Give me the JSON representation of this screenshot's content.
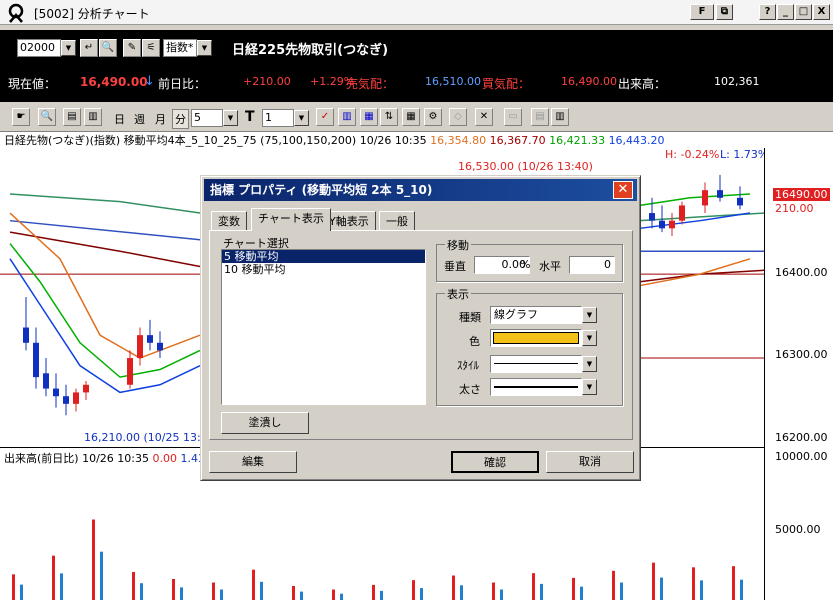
{
  "window": {
    "title": "[5002] 分析チャート",
    "btn_f": "F",
    "btn_help": "?",
    "btn_min": "_",
    "btn_max": "□",
    "btn_close": "X"
  },
  "top": {
    "code": "02000",
    "interval": "指数*",
    "instrument": "日経225先物取引(つなぎ)"
  },
  "quote": {
    "current_label": "現在値：",
    "current_value": "16,490.00",
    "arrow": "↓",
    "prev_label": "前日比：",
    "change": "+210.00",
    "change_pct": "+1.29%",
    "ask_label": "売気配：",
    "ask_value": "16,510.00",
    "bid_label": "買気配：",
    "bid_value": "16,490.00",
    "volume_label": "出来高：",
    "volume_value": "102,361"
  },
  "toolbar": {
    "day": "日",
    "week": "週",
    "month": "月",
    "minute": "分",
    "minute_value": "5",
    "t_value": "1",
    "t_label": "T"
  },
  "legend": {
    "main": "日経先物(つなぎ)(指数) 移動平均4本_5_10_25_75 (75,100,150,200) 10/26 10:35",
    "v1": "16,354.80",
    "v2": "16,367.70",
    "v3": "16,421.33",
    "v4": "16,443.20"
  },
  "annotations": {
    "high": "16,530.00 (10/26 13:40)",
    "low": "16,210.00 (10/25 13:",
    "h_label": "H: -0.24%",
    "l_label": "L: 1.73%"
  },
  "axis": {
    "price_current": "16490.00",
    "price_change": "210.00",
    "ticks": [
      "16400.00",
      "16300.00",
      "16200.00"
    ],
    "vol_ticks": [
      "10000.00",
      "5000.00"
    ]
  },
  "volume": {
    "legend": "出来高(前日比) 10/26 10:35",
    "v_neg": "0.00",
    "v_pos": "1.43"
  },
  "dialog": {
    "title": "指標 プロパティ (移動平均短 2本 5_10)",
    "tabs": [
      "変数",
      "チャート表示",
      "Y軸表示",
      "一般"
    ],
    "list_label": "チャート選択",
    "items": [
      "5 移動平均",
      "10 移動平均"
    ],
    "clear_button": "塗潰し",
    "move_group": "移動",
    "vertical_label": "垂直",
    "vertical_value": "0.00",
    "percent": "%",
    "horizontal_label": "水平",
    "horizontal_value": "0",
    "display_group": "表示",
    "type_label": "種類",
    "type_value": "線グラフ",
    "color_label": "色",
    "color_value": "#f2c21a",
    "style_label": "ｽﾀｲﾙ",
    "width_label": "太さ",
    "edit_button": "編集",
    "ok_button": "確認",
    "cancel_button": "取消"
  },
  "colors": {
    "up": "#e02020",
    "down": "#1030c0",
    "ma5": "#00b000",
    "ma10": "#1040e0",
    "ma25": "#e07020",
    "ma75": "#800000"
  },
  "chart_data": {
    "type": "candlestick",
    "title": "日経先物(つなぎ)(指数)",
    "ylim": [
      16180,
      16560
    ],
    "candles": [
      [
        16330,
        16370,
        16300,
        16310
      ],
      [
        16310,
        16330,
        16250,
        16265
      ],
      [
        16270,
        16290,
        16240,
        16250
      ],
      [
        16250,
        16270,
        16225,
        16240
      ],
      [
        16240,
        16255,
        16215,
        16230
      ],
      [
        16230,
        16250,
        16220,
        16245
      ],
      [
        16245,
        16260,
        16235,
        16255
      ],
      [
        16255,
        16300,
        16250,
        16290
      ],
      [
        16290,
        16330,
        16280,
        16320
      ],
      [
        16320,
        16340,
        16300,
        16310
      ],
      [
        16310,
        16325,
        16290,
        16300
      ],
      [
        16480,
        16500,
        16460,
        16470
      ],
      [
        16470,
        16490,
        16455,
        16460
      ],
      [
        16460,
        16480,
        16450,
        16470
      ],
      [
        16470,
        16495,
        16465,
        16490
      ],
      [
        16490,
        16520,
        16480,
        16510
      ],
      [
        16510,
        16530,
        16495,
        16500
      ],
      [
        16500,
        16515,
        16485,
        16490
      ]
    ],
    "volume": [
      2200,
      3800,
      6900,
      2400,
      1800,
      1500,
      2600,
      1200,
      900,
      1300,
      1700,
      2100,
      1500,
      2300,
      1900,
      2500,
      3200,
      2800,
      2900
    ]
  }
}
